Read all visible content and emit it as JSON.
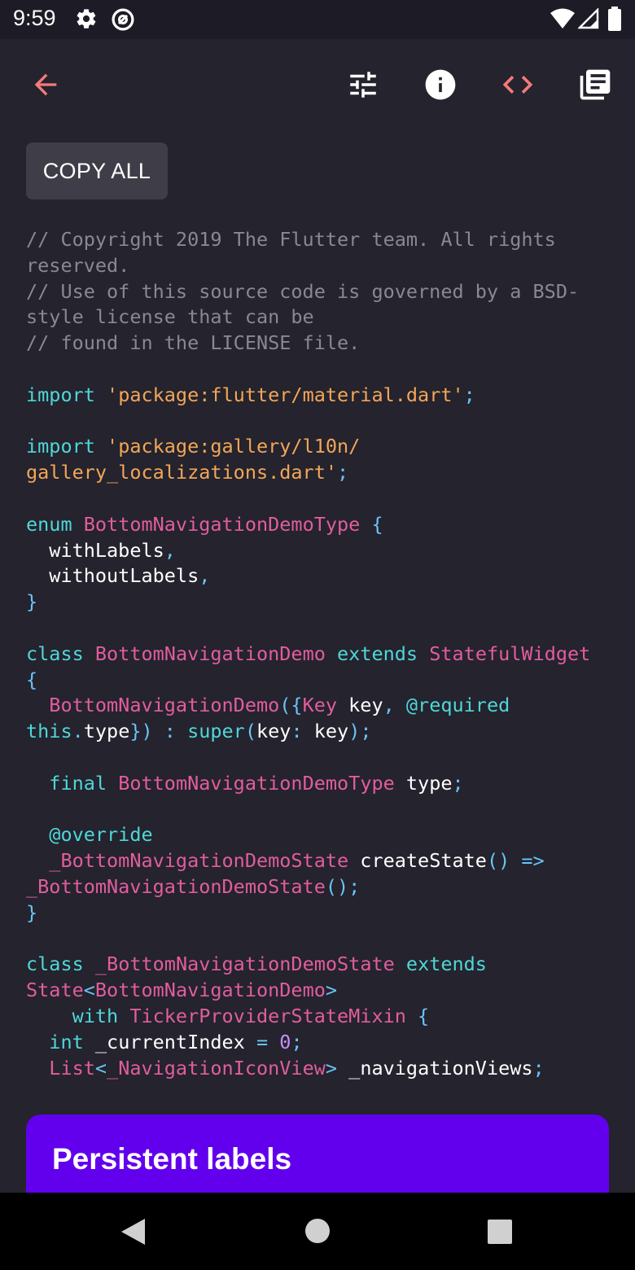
{
  "status_bar": {
    "time": "9:59",
    "icons": [
      "settings-icon",
      "at-sign-icon",
      "wifi-icon",
      "signal-icon",
      "battery-icon"
    ]
  },
  "toolbar": {
    "back_icon": "arrow-back-icon",
    "actions": [
      "tune-icon",
      "info-icon",
      "code-icon",
      "library-books-icon"
    ],
    "accent_color": "#f57a7a"
  },
  "copy_all_label": "COPY ALL",
  "code": {
    "lines": [
      [
        {
          "t": "// Copyright 2019 The Flutter team. All rights",
          "k": "cm"
        }
      ],
      [
        {
          "t": "reserved.",
          "k": "cm"
        }
      ],
      [
        {
          "t": "// Use of this source code is governed by a BSD-",
          "k": "cm"
        }
      ],
      [
        {
          "t": "style license that can be",
          "k": "cm"
        }
      ],
      [
        {
          "t": "// found in the LICENSE file.",
          "k": "cm"
        }
      ],
      [],
      [
        {
          "t": "import",
          "k": "kw"
        },
        {
          "t": " ",
          "k": "id"
        },
        {
          "t": "'package:flutter/material.dart'",
          "k": "st"
        },
        {
          "t": ";",
          "k": "pu"
        }
      ],
      [],
      [
        {
          "t": "import",
          "k": "kw"
        },
        {
          "t": " ",
          "k": "id"
        },
        {
          "t": "'package:gallery/l10n/",
          "k": "st"
        }
      ],
      [
        {
          "t": "gallery_localizations.dart'",
          "k": "st"
        },
        {
          "t": ";",
          "k": "pu"
        }
      ],
      [],
      [
        {
          "t": "enum",
          "k": "kw"
        },
        {
          "t": " ",
          "k": "id"
        },
        {
          "t": "BottomNavigationDemoType",
          "k": "cl"
        },
        {
          "t": " {",
          "k": "pu"
        }
      ],
      [
        {
          "t": "  withLabels",
          "k": "id"
        },
        {
          "t": ",",
          "k": "pu"
        }
      ],
      [
        {
          "t": "  withoutLabels",
          "k": "id"
        },
        {
          "t": ",",
          "k": "pu"
        }
      ],
      [
        {
          "t": "}",
          "k": "pu"
        }
      ],
      [],
      [
        {
          "t": "class",
          "k": "kw"
        },
        {
          "t": " ",
          "k": "id"
        },
        {
          "t": "BottomNavigationDemo",
          "k": "cl"
        },
        {
          "t": " ",
          "k": "id"
        },
        {
          "t": "extends",
          "k": "kw"
        },
        {
          "t": " ",
          "k": "id"
        },
        {
          "t": "StatefulWidget",
          "k": "cl"
        }
      ],
      [
        {
          "t": "{",
          "k": "pu"
        }
      ],
      [
        {
          "t": "  ",
          "k": "id"
        },
        {
          "t": "BottomNavigationDemo",
          "k": "cl"
        },
        {
          "t": "({",
          "k": "pu"
        },
        {
          "t": "Key",
          "k": "cl"
        },
        {
          "t": " key",
          "k": "id"
        },
        {
          "t": ", ",
          "k": "pu"
        },
        {
          "t": "@required",
          "k": "an"
        }
      ],
      [
        {
          "t": "this",
          "k": "kw"
        },
        {
          "t": ".",
          "k": "pu"
        },
        {
          "t": "type",
          "k": "id"
        },
        {
          "t": "}) : ",
          "k": "pu"
        },
        {
          "t": "super",
          "k": "kw"
        },
        {
          "t": "(",
          "k": "pu"
        },
        {
          "t": "key",
          "k": "id"
        },
        {
          "t": ": ",
          "k": "pu"
        },
        {
          "t": "key",
          "k": "id"
        },
        {
          "t": ");",
          "k": "pu"
        }
      ],
      [],
      [
        {
          "t": "  ",
          "k": "id"
        },
        {
          "t": "final",
          "k": "kw"
        },
        {
          "t": " ",
          "k": "id"
        },
        {
          "t": "BottomNavigationDemoType",
          "k": "cl"
        },
        {
          "t": " type",
          "k": "id"
        },
        {
          "t": ";",
          "k": "pu"
        }
      ],
      [],
      [
        {
          "t": "  @override",
          "k": "an"
        }
      ],
      [
        {
          "t": "  ",
          "k": "id"
        },
        {
          "t": "_BottomNavigationDemoState",
          "k": "cl"
        },
        {
          "t": " createState",
          "k": "id"
        },
        {
          "t": "() =>",
          "k": "pu"
        }
      ],
      [
        {
          "t": "_BottomNavigationDemoState",
          "k": "cl"
        },
        {
          "t": "();",
          "k": "pu"
        }
      ],
      [
        {
          "t": "}",
          "k": "pu"
        }
      ],
      [],
      [
        {
          "t": "class",
          "k": "kw"
        },
        {
          "t": " ",
          "k": "id"
        },
        {
          "t": "_BottomNavigationDemoState",
          "k": "cl"
        },
        {
          "t": " ",
          "k": "id"
        },
        {
          "t": "extends",
          "k": "kw"
        }
      ],
      [
        {
          "t": "State",
          "k": "cl"
        },
        {
          "t": "<",
          "k": "pu"
        },
        {
          "t": "BottomNavigationDemo",
          "k": "cl"
        },
        {
          "t": ">",
          "k": "pu"
        }
      ],
      [
        {
          "t": "    ",
          "k": "id"
        },
        {
          "t": "with",
          "k": "kw"
        },
        {
          "t": " ",
          "k": "id"
        },
        {
          "t": "TickerProviderStateMixin",
          "k": "cl"
        },
        {
          "t": " {",
          "k": "pu"
        }
      ],
      [
        {
          "t": "  ",
          "k": "id"
        },
        {
          "t": "int",
          "k": "kw"
        },
        {
          "t": " _currentIndex",
          "k": "id"
        },
        {
          "t": " = ",
          "k": "pu"
        },
        {
          "t": "0",
          "k": "nu"
        },
        {
          "t": ";",
          "k": "pu"
        }
      ],
      [
        {
          "t": "  ",
          "k": "id"
        },
        {
          "t": "List",
          "k": "cl"
        },
        {
          "t": "<",
          "k": "pu"
        },
        {
          "t": "_NavigationIconView",
          "k": "cl"
        },
        {
          "t": ">",
          "k": "pu"
        },
        {
          "t": " _navigationViews",
          "k": "id"
        },
        {
          "t": ";",
          "k": "pu"
        }
      ]
    ]
  },
  "preview": {
    "title": "Persistent labels",
    "background_color": "#6200ee"
  },
  "nav_bar": {
    "icons": [
      "back-triangle-icon",
      "home-circle-icon",
      "recents-square-icon"
    ]
  }
}
